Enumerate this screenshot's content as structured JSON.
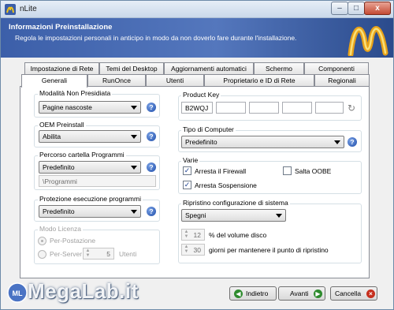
{
  "window": {
    "title": "nLite",
    "minimize": "–",
    "maximize": "□",
    "close": "x"
  },
  "header": {
    "title": "Informazioni Preinstallazione",
    "subtitle": "Regola le impostazioni personali in anticipo in modo da non doverlo fare durante l'installazione."
  },
  "tabs": {
    "row1": [
      "Impostazione di Rete",
      "Temi del Desktop",
      "Aggiornamenti automatici",
      "Schermo",
      "Componenti"
    ],
    "row2": [
      "Generali",
      "RunOnce",
      "Utenti",
      "Proprietario e ID di Rete",
      "Regionali"
    ],
    "active": "Generali"
  },
  "left": {
    "unattended": {
      "label": "Modalità Non Presidiata",
      "value": "Pagine nascoste"
    },
    "oem": {
      "label": "OEM Preinstall",
      "value": "Abilita"
    },
    "programfiles": {
      "label": "Percorso cartella Programmi",
      "value": "Predefinito",
      "path": "\\Programmi"
    },
    "protection": {
      "label": "Protezione esecuzione programmi",
      "value": "Predefinito"
    },
    "license": {
      "label": "Modo Licenza",
      "per_seat": "Per-Postazione",
      "per_server": "Per-Server",
      "users_value": "5",
      "users_label": "Utenti"
    }
  },
  "right": {
    "productkey": {
      "label": "Product Key",
      "parts": [
        "B2WQJ",
        "",
        "",
        "",
        ""
      ]
    },
    "computertype": {
      "label": "Tipo di Computer",
      "value": "Predefinito"
    },
    "misc": {
      "label": "Varie",
      "firewall": "Arresta il Firewall",
      "oobe": "Salta OOBE",
      "hibernate": "Arresta Sospensione"
    },
    "restore": {
      "label": "Ripristino configurazione di sistema",
      "value": "Spegni",
      "disk_value": "12",
      "disk_label": "% del volume disco",
      "days_value": "30",
      "days_label": "giorni per mantenere il punto di ripristino"
    }
  },
  "buttons": {
    "back": "Indietro",
    "next": "Avanti",
    "cancel": "Cancella",
    "help_glyph": "?"
  },
  "watermark": {
    "text": "MegaLab.it"
  }
}
